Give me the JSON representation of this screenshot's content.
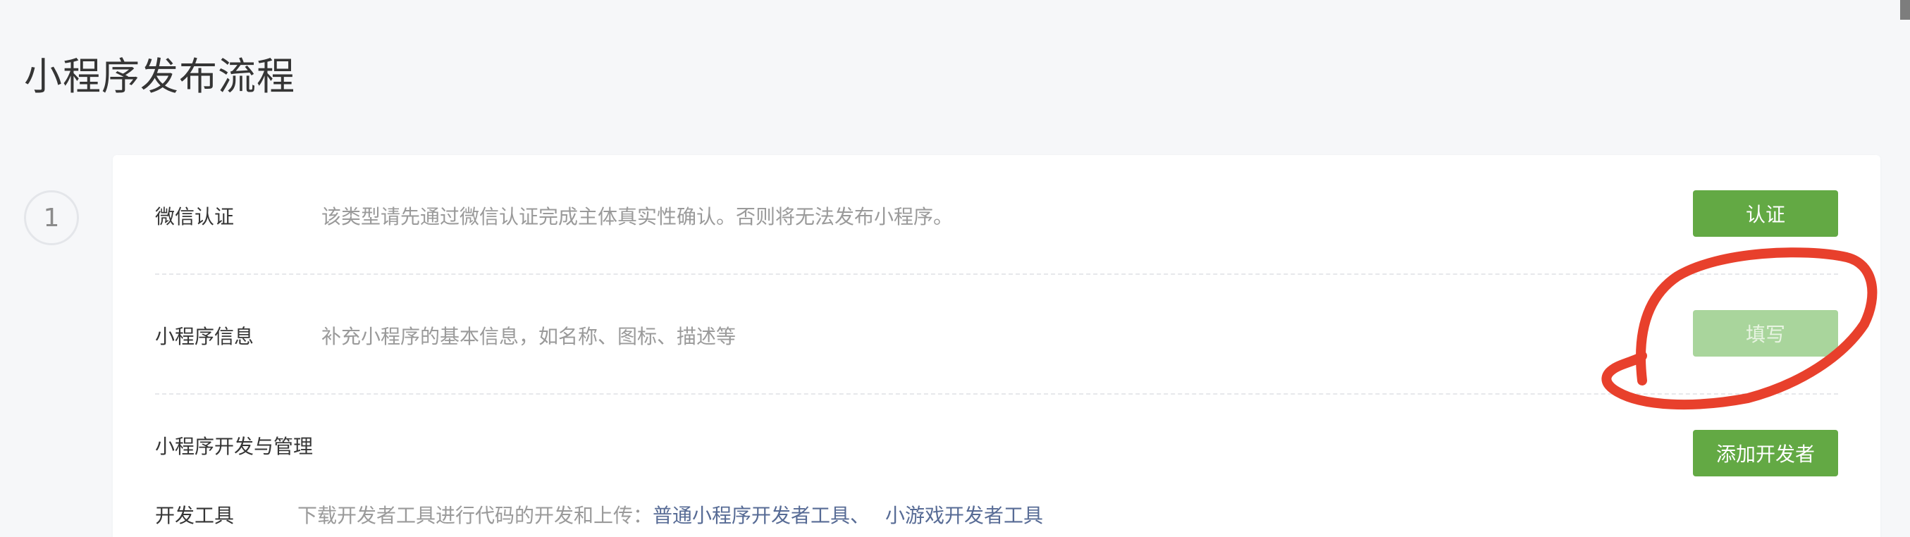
{
  "page": {
    "title": "小程序发布流程"
  },
  "step": {
    "number": "1"
  },
  "rows": [
    {
      "label": "微信认证",
      "description": "该类型请先通过微信认证完成主体真实性确认。否则将无法发布小程序。",
      "button": "认证",
      "button_state": "enabled"
    },
    {
      "label": "小程序信息",
      "description": "补充小程序的基本信息，如名称、图标、描述等",
      "button": "填写",
      "button_state": "disabled"
    },
    {
      "label": "小程序开发与管理",
      "button": "添加开发者",
      "button_state": "enabled"
    }
  ],
  "dev_tools": {
    "label": "开发工具",
    "description": "下载开发者工具进行代码的开发和上传：",
    "links": [
      "普通小程序开发者工具",
      "小游戏开发者工具"
    ],
    "separator": "、"
  },
  "annotation": {
    "shape": "hand-drawn circle",
    "color": "#e8402c",
    "target": "填写"
  },
  "colors": {
    "primary_button": "#63a944",
    "disabled_button": "#a9d59c",
    "link": "#576b95",
    "background": "#f6f7f9"
  }
}
